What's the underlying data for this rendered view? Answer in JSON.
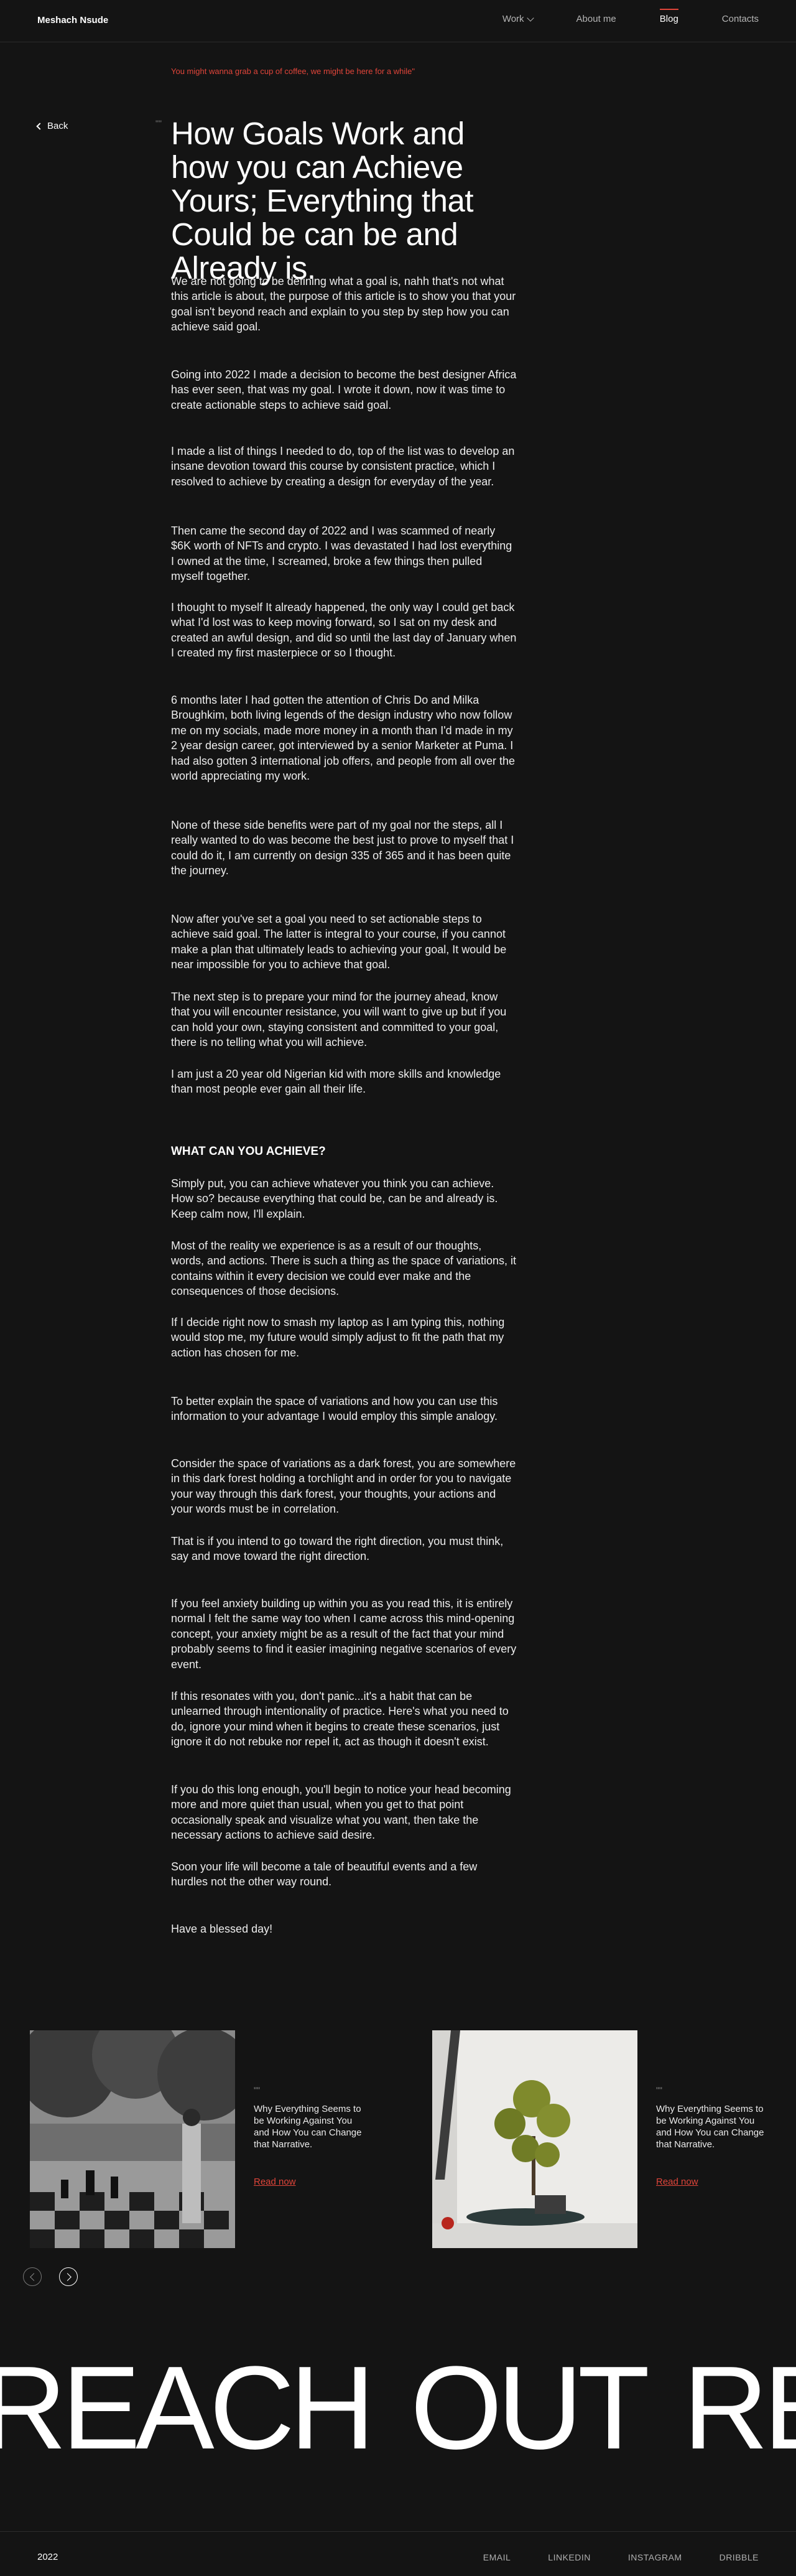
{
  "nav": {
    "brand": "Meshach Nsude",
    "links": [
      "Work",
      "About me",
      "Blog",
      "Contacts"
    ]
  },
  "article": {
    "coffee_note": "You might wanna grab a cup of coffee, we might be here for a while\"",
    "back_label": "Back",
    "quote_mark": "\"\"",
    "title": "How Goals Work and how you can Achieve Yours; Everything that Could be can be and Already is.",
    "paragraphs": [
      "We are not going to be defining what a goal is, nahh that's not what this article is about, the purpose of this article is to show you that your goal isn't beyond reach and explain to you step by step how you can achieve said goal.",
      "Going into 2022 I made a decision to become the best designer Africa has ever seen, that was my goal. I wrote it down, now it was time to create actionable steps to achieve said goal.",
      "I made a list of things I needed to do, top of the list was to develop an insane devotion toward this course by consistent practice, which I resolved to achieve by creating a design for everyday of the year.",
      "Then came the second day of 2022 and I was scammed of nearly $6K worth of NFTs and crypto. I was devastated I had lost everything I owned at the time, I screamed, broke a few things then pulled myself together.",
      "I thought to myself It already happened, the only way I could get back what I'd lost was to keep moving forward, so I sat on my desk and created an awful design, and did so until the last day of January when I created my first masterpiece or so I thought.",
      "6 months later I had gotten the attention of Chris Do and Milka Broughkim, both living legends of the design industry who now follow me on my socials, made more money in a month than I'd made in my 2 year design career, got interviewed by a senior Marketer at Puma. I had also gotten 3 international job offers, and people from all over the world appreciating my work.",
      "None of these side benefits were part of my goal nor the steps, all I really wanted to do was become the best just to prove to myself that I could do it, I am currently on design 335 of 365 and it has been quite the journey.",
      "Now after you've set a goal you need to set actionable steps to achieve said goal. The latter is integral to your course, if you cannot make a plan that ultimately leads to achieving your goal, It would be near impossible for you to achieve that goal.",
      "The next step is to prepare your mind for the journey ahead, know that you will encounter resistance, you will want to give up but if you can hold your own, staying consistent and committed to your goal, there is no telling what you will achieve.",
      "I am just a 20 year old Nigerian kid with more skills and knowledge than most people ever gain all their life.",
      "Simply put, you can achieve whatever you think you can achieve. How so? because everything that could be, can be and already is. Keep calm now, I'll explain.",
      "Most of the reality we experience is as a result of our thoughts, words, and actions. There is such a thing as the space of variations, it contains within it every decision we could ever make and the consequences of those decisions.",
      "If I decide right now to smash my laptop as I am typing this, nothing would stop me, my future would simply adjust to fit the path that my action has chosen for me.",
      "To better explain the space of variations and how you can use this information to your advantage I would employ this simple analogy.",
      "Consider the space of variations as a dark forest, you are somewhere in this dark forest holding a torchlight and in order for you to navigate your way through this dark forest, your thoughts, your actions and your words must be in correlation.",
      "That is if you intend to go toward the right direction, you must think, say and move toward the right direction.",
      "If you feel anxiety building up within you as you read this, it is entirely normal I felt the same way too when I came across this mind-opening concept, your anxiety might be as a result of the fact that your mind probably seems to find it easier imagining negative scenarios of every event.",
      "If this resonates with you, don't panic...it's a habit that can be unlearned through intentionality of practice. Here's what you need to do, ignore your mind when it begins to create these scenarios, just ignore it do not rebuke nor repel it, act as though it doesn't exist.",
      "If you do this long enough, you'll begin to notice your head becoming more and more quiet than usual, when you get to that point occasionally speak and visualize what you want, then take the necessary actions to achieve said desire.",
      "Soon your life will become a tale of beautiful events and a few hurdles not the other way round.",
      "Have a blessed day!"
    ],
    "section_heading": "WHAT CAN YOU ACHIEVE?"
  },
  "related": {
    "cards": [
      {
        "quote": "\"\"",
        "text": "Why Everything Seems to be Working Against You and How You can Change that Narrative.",
        "link": "Read now"
      },
      {
        "quote": "\"\"",
        "text": "Why Everything Seems to be Working Against You and How You can Change that Narrative.",
        "link": "Read now"
      }
    ]
  },
  "marquee": {
    "text": "REACH OUT REACH OUT REACH OUT"
  },
  "footer": {
    "year": "2022",
    "links": [
      "EMAIL",
      "LINKEDIN",
      "INSTAGRAM",
      "DRIBBLE"
    ]
  },
  "colors": {
    "background": "#141414",
    "accent": "#e0453a",
    "text": "#f2f2f2"
  },
  "icons": [
    "chevron-down-icon",
    "back-arrow-icon",
    "arrow-left-icon",
    "arrow-right-icon"
  ]
}
